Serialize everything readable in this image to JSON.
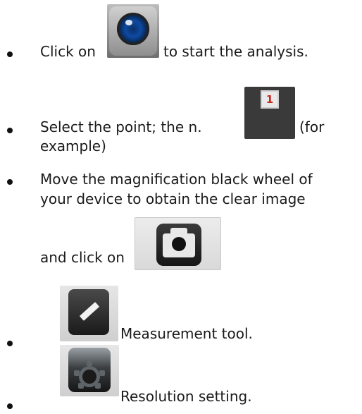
{
  "steps": [
    {
      "before_icon": "Click on",
      "after_icon": "to start the analysis.",
      "icon": "camera-lens-icon"
    },
    {
      "before_icon": "Select the point; the n.",
      "after_icon": "(for",
      "continuation": "example)",
      "icon": "point-1-icon",
      "icon_label": "1"
    },
    {
      "line1": "Move the magnification black wheel of",
      "line2": "your device  to obtain the clear  image",
      "line3": "and click on",
      "icon": "camera-shoot-icon"
    },
    {
      "after_icon": "Measurement tool.",
      "icon": "ruler-icon"
    },
    {
      "after_icon": "Resolution setting.",
      "icon": "gear-settings-icon"
    }
  ],
  "colors": {
    "text": "#1a1a1a",
    "point_number": "#c62a1d",
    "lens_blue": "#0e4aa3"
  }
}
